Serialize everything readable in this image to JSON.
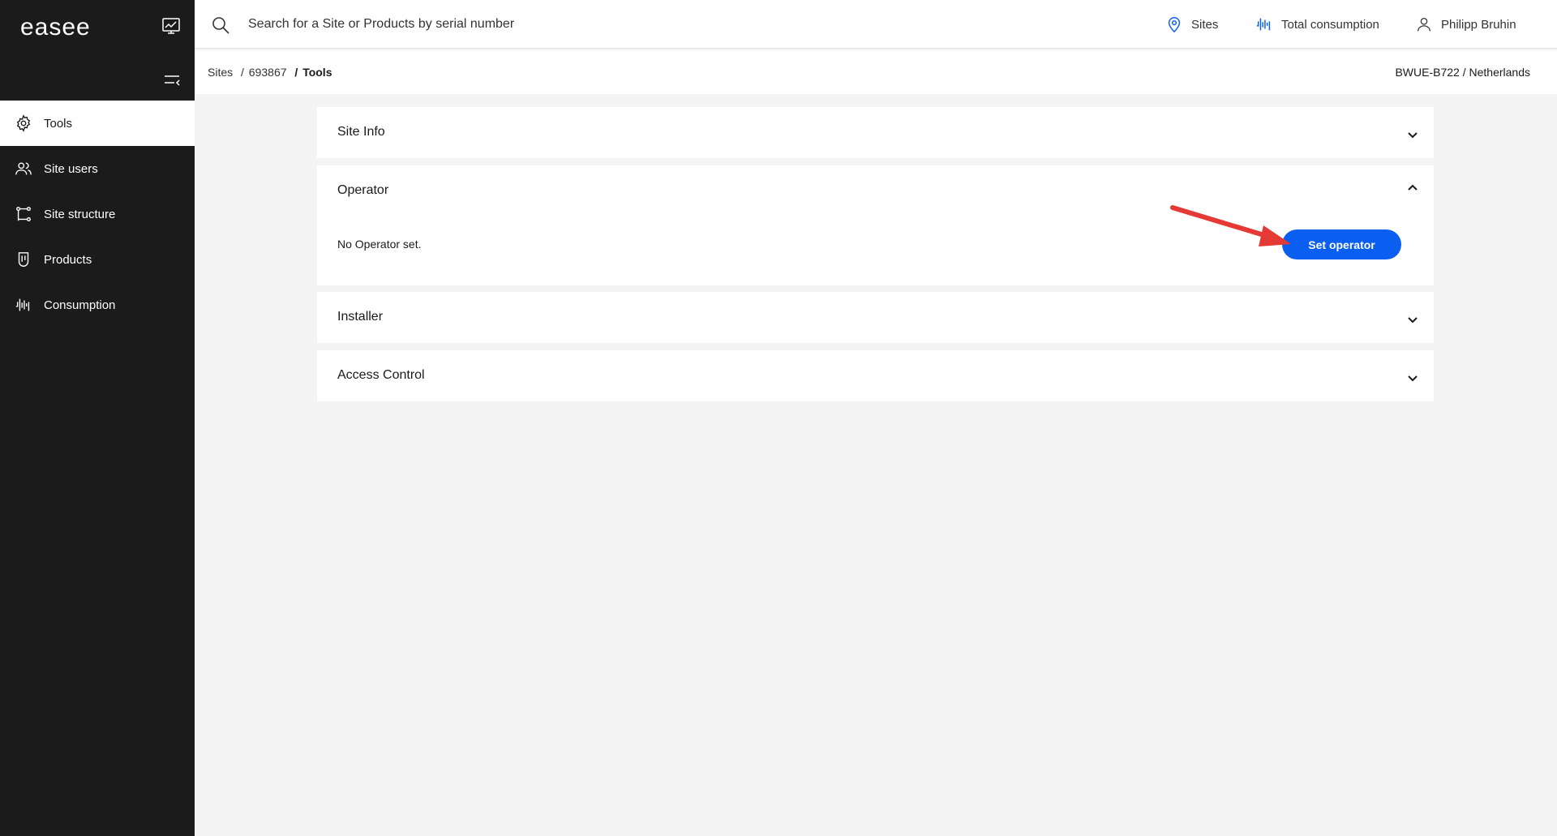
{
  "brand": {
    "logo_text": "easee"
  },
  "sidebar": {
    "items": [
      {
        "label": "Tools",
        "icon": "gear-icon",
        "active": true
      },
      {
        "label": "Site users",
        "icon": "users-icon"
      },
      {
        "label": "Site structure",
        "icon": "site-structure-icon"
      },
      {
        "label": "Products",
        "icon": "charger-icon"
      },
      {
        "label": "Consumption",
        "icon": "consumption-icon"
      }
    ]
  },
  "topbar": {
    "search_placeholder": "Search for a Site or Products by serial number",
    "sites_label": "Sites",
    "total_consumption_label": "Total consumption",
    "user_name": "Philipp Bruhin"
  },
  "breadcrumb": {
    "items": [
      "Sites",
      "693867",
      "Tools"
    ],
    "separator": "/",
    "right_text": "BWUE-B722 / Netherlands"
  },
  "panels": {
    "site_info": {
      "title": "Site Info",
      "expanded": false
    },
    "operator": {
      "title": "Operator",
      "expanded": true,
      "body_text": "No Operator set.",
      "button_label": "Set operator"
    },
    "installer": {
      "title": "Installer",
      "expanded": false
    },
    "access_control": {
      "title": "Access Control",
      "expanded": false
    }
  },
  "colors": {
    "sidebar_bg": "#1b1b1b",
    "accent_blue": "#0a5ff0",
    "annotation_red": "#e53935"
  }
}
